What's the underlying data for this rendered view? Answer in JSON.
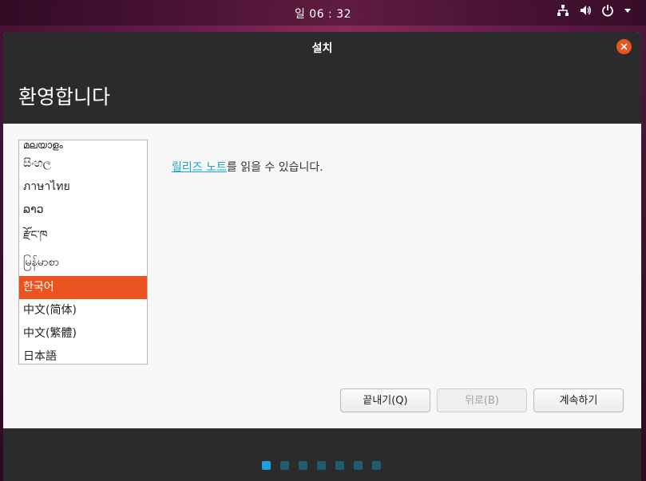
{
  "desktop": {
    "clock": "일 06 : 32"
  },
  "window": {
    "title": "설치",
    "page_title": "환영합니다"
  },
  "language_list": {
    "items": [
      "മലയാളം",
      "සිංහල",
      "ภาษาไทย",
      "ລາວ",
      "རྫོང་ཁ",
      "မြန်မာစာ",
      "한국어",
      "中文(简体)",
      "中文(繁體)",
      "日本語"
    ],
    "selected": "한국어"
  },
  "release_notes": {
    "link_text": "릴리즈 노트",
    "rest_text": "를 읽을 수 있습니다."
  },
  "buttons": {
    "quit": "끝내기(Q)",
    "back": "뒤로(B)",
    "continue": "계속하기"
  },
  "progress": {
    "current_step": 1,
    "total_steps": 7
  },
  "colors": {
    "accent": "#e95420",
    "link": "#19a5d4",
    "dot_active": "#1aa1de",
    "dot_inactive": "#1f5c72"
  }
}
